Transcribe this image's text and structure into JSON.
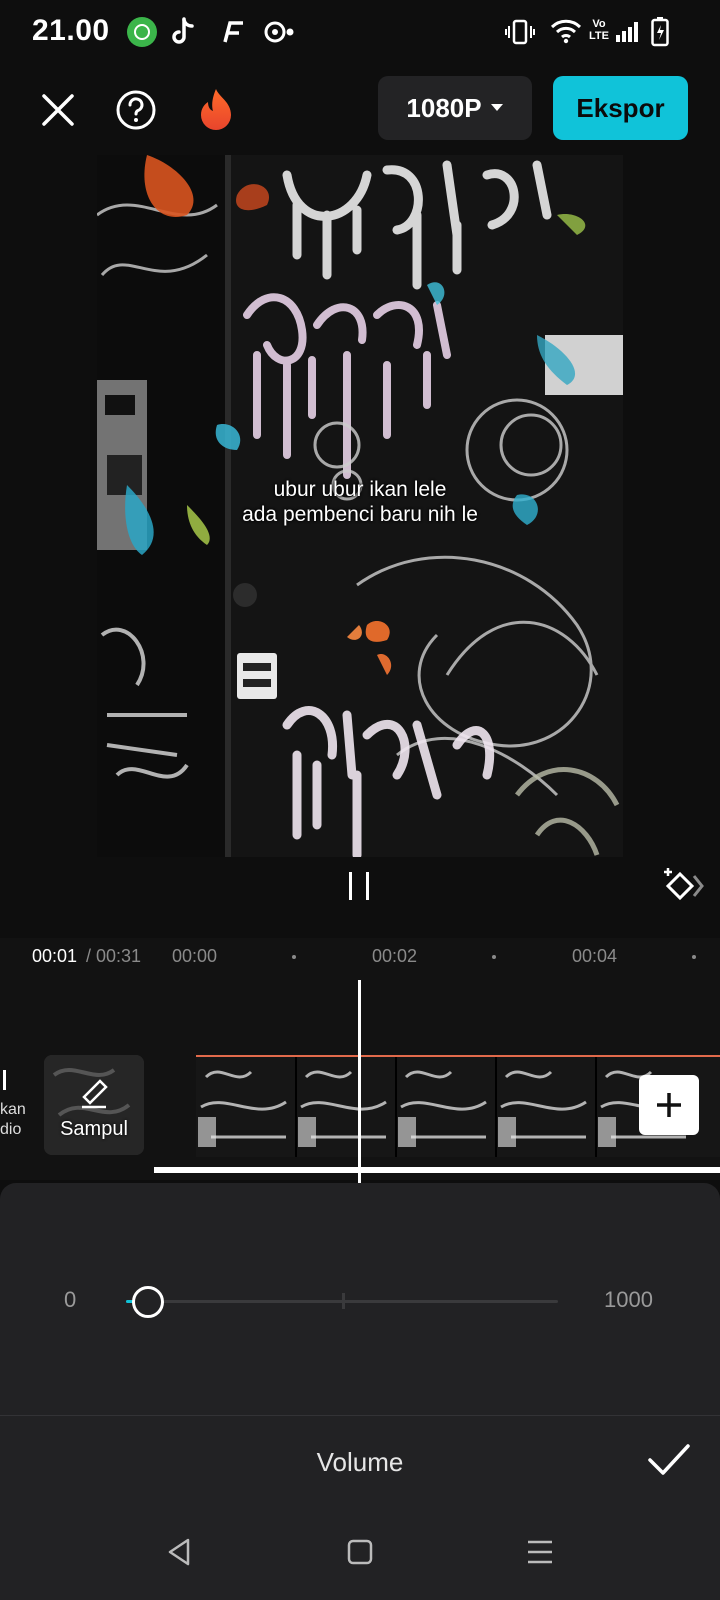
{
  "status_bar": {
    "time": "21.00",
    "icons": [
      "whatsapp-business-icon",
      "tiktok-icon",
      "app-f-icon",
      "screen-record-icon",
      "vibrate-icon",
      "wifi-icon",
      "volte-icon",
      "signal-icon",
      "battery-charging-icon"
    ],
    "volte_label": "Vo LTE"
  },
  "toolbar": {
    "close_icon": "close-icon",
    "help_icon": "help-icon",
    "pro_icon": "flame-icon",
    "resolution": "1080P",
    "export_label": "Ekspor"
  },
  "preview": {
    "subtitle_line1": "ubur ubur ikan lele",
    "subtitle_line2": "ada pembenci baru nih le"
  },
  "timeline": {
    "current_time": "00:01",
    "total_time": "/ 00:31",
    "ticks": [
      "00:00",
      "00:02",
      "00:04"
    ],
    "audio_label": "kan\ndio",
    "cover_label": "Sampul"
  },
  "panel": {
    "title": "Volume",
    "slider_min": "0",
    "slider_max": "1000",
    "slider_value": 100
  },
  "colors": {
    "accent": "#10c3d9",
    "background": "#0e0e0e",
    "panel": "#222224",
    "clip_border": "#e26a4b"
  }
}
